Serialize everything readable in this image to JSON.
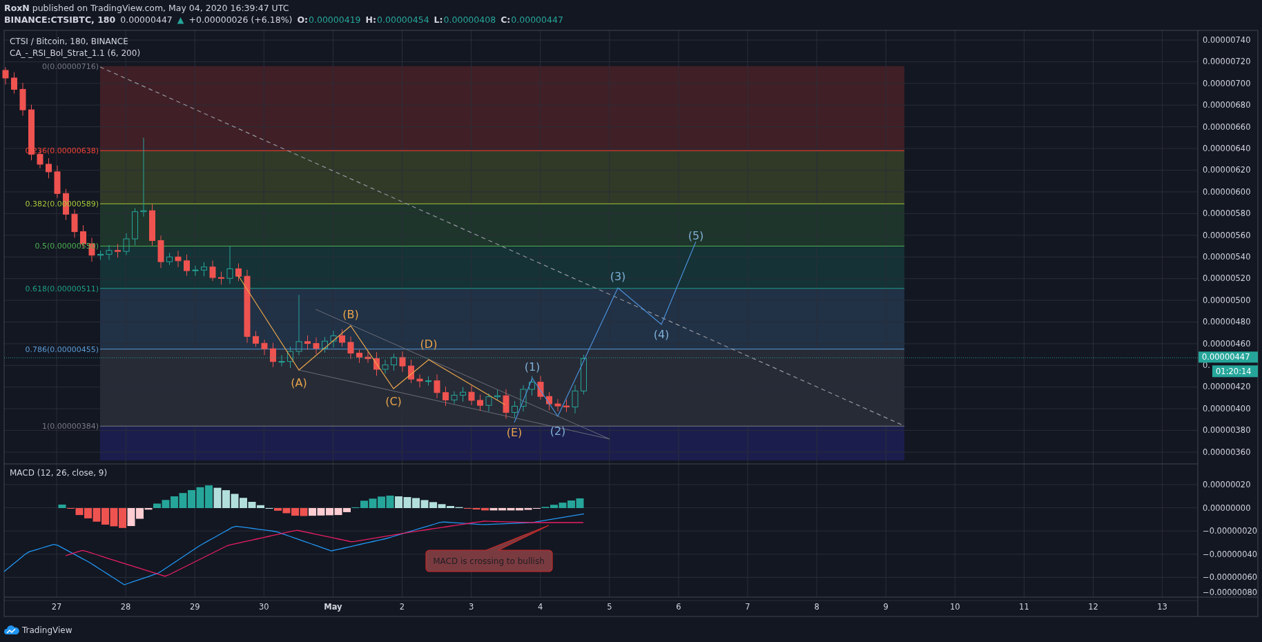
{
  "header": {
    "byline": "**RoxN** published on TradingView.com, May 04, 2020 16:39:47 UTC",
    "symbol": "BINANCE:CTSIBTC, 180",
    "price": "0.00000447",
    "direction_arrow": "▲",
    "change": "+0.00000026 (+6.18%)",
    "ohlc": [
      {
        "label": "O:",
        "value": "0.00000419"
      },
      {
        "label": "H:",
        "value": "0.00000454"
      },
      {
        "label": "L:",
        "value": "0.00000408"
      },
      {
        "label": "C:",
        "value": "0.00000447"
      }
    ]
  },
  "chart": {
    "title": "CTSI / Bitcoin, 180, BINANCE",
    "indicator": "CA_-_RSI_Bol_Strat_1.1 (6, 200)",
    "price_axis": [
      "0.00000740",
      "0.00000720",
      "0.00000700",
      "0.00000680",
      "0.00000660",
      "0.00000640",
      "0.00000620",
      "0.00000600",
      "0.00000580",
      "0.00000560",
      "0.00000540",
      "0.00000520",
      "0.00000500",
      "0.00000480",
      "0.00000460",
      "0.",
      "0.00000420",
      "0.00000400",
      "0.00000380",
      "0.00000360"
    ],
    "last_price": "0.00000447",
    "countdown": "01:20:14",
    "fib_levels": [
      {
        "label": "0(0.00000716)",
        "color": "#787b86"
      },
      {
        "label": "0.236(0.00000638)",
        "color": "#f44336"
      },
      {
        "label": "0.382(0.00000589)",
        "color": "#a5c93a"
      },
      {
        "label": "0.5(0.00000550)",
        "color": "#4caf50"
      },
      {
        "label": "0.618(0.00000511)",
        "color": "#1e9e86"
      },
      {
        "label": "0.786(0.00000455)",
        "color": "#5b9bd5"
      },
      {
        "label": "1(0.00000384)",
        "color": "#787b86"
      }
    ],
    "wave_labels": [
      {
        "label": "(A)",
        "color": "#e8a54b"
      },
      {
        "label": "(B)",
        "color": "#e8a54b"
      },
      {
        "label": "(C)",
        "color": "#e8a54b"
      },
      {
        "label": "(D)",
        "color": "#e8a54b"
      },
      {
        "label": "(E)",
        "color": "#e8a54b"
      },
      {
        "label": "(1)",
        "color": "#7fb0d8"
      },
      {
        "label": "(2)",
        "color": "#7fb0d8"
      },
      {
        "label": "(3)",
        "color": "#7fb0d8"
      },
      {
        "label": "(4)",
        "color": "#7fb0d8"
      },
      {
        "label": "(5)",
        "color": "#7fb0d8"
      }
    ],
    "macd": {
      "title": "MACD (12, 26, close, 9)",
      "axis": [
        "0.00000020",
        "0.00000000",
        "−0.00000020",
        "−0.00000040",
        "−0.00000060",
        "−0.00000080"
      ],
      "note": "MACD is crossing to bullish"
    },
    "time_axis": [
      {
        "label": "27",
        "kind": "day"
      },
      {
        "label": "28",
        "kind": "day"
      },
      {
        "label": "29",
        "kind": "day"
      },
      {
        "label": "30",
        "kind": "day"
      },
      {
        "label": "May",
        "kind": "month"
      },
      {
        "label": "2",
        "kind": "day"
      },
      {
        "label": "3",
        "kind": "day"
      },
      {
        "label": "4",
        "kind": "day"
      },
      {
        "label": "5",
        "kind": "day"
      },
      {
        "label": "6",
        "kind": "day"
      },
      {
        "label": "7",
        "kind": "day"
      },
      {
        "label": "8",
        "kind": "day"
      },
      {
        "label": "9",
        "kind": "day"
      },
      {
        "label": "10",
        "kind": "day"
      },
      {
        "label": "11",
        "kind": "day"
      },
      {
        "label": "12",
        "kind": "day"
      },
      {
        "label": "13",
        "kind": "day"
      }
    ]
  },
  "footer": {
    "brand": "TradingView"
  }
}
